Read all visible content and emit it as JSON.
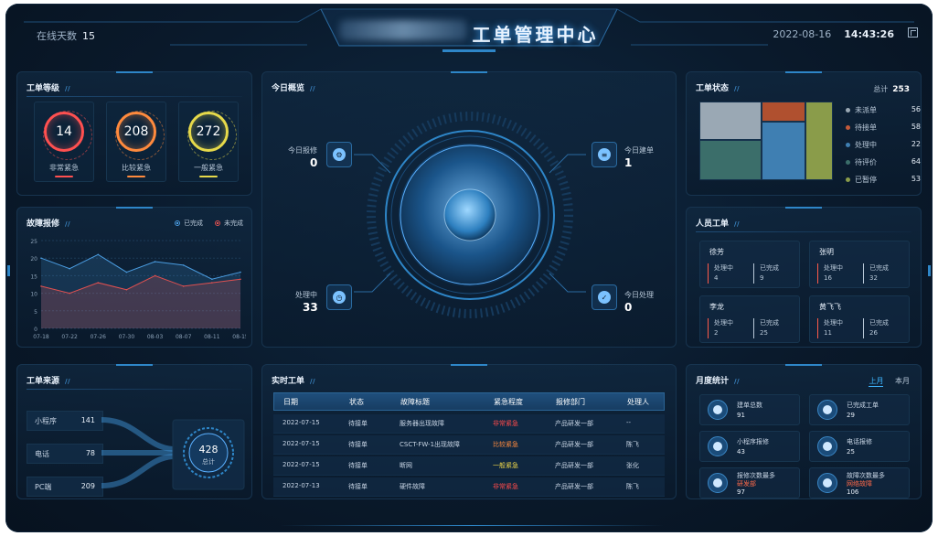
{
  "header": {
    "title": "工单管理中心",
    "online_label": "在线天数",
    "online_days": "15",
    "date": "2022-08-16",
    "time": "14:43:26",
    "fullscreen_icon": "fullscreen-icon"
  },
  "level": {
    "title": "工单等级",
    "items": [
      {
        "value": "14",
        "label": "非常紧急",
        "color": "#ff5050"
      },
      {
        "value": "208",
        "label": "比较紧急",
        "color": "#ff8a3d"
      },
      {
        "value": "272",
        "label": "一般紧急",
        "color": "#e6d94a"
      }
    ]
  },
  "fault": {
    "title": "故障报修",
    "legend_done": "已完成",
    "legend_undone": "未完成",
    "done_color": "#4a9ce0",
    "undone_color": "#e05050"
  },
  "chart_data": {
    "type": "area",
    "title": "故障报修",
    "categories": [
      "07-18",
      "07-22",
      "07-26",
      "07-30",
      "08-03",
      "08-07",
      "08-11",
      "08-15"
    ],
    "ylim": [
      0,
      25
    ],
    "yticks": [
      "25",
      "20",
      "15",
      "10",
      "5",
      "0"
    ],
    "series": [
      {
        "name": "已完成",
        "values": [
          20,
          17,
          21,
          16,
          19,
          18,
          14,
          16
        ]
      },
      {
        "name": "未完成",
        "values": [
          12,
          10,
          13,
          11,
          15,
          12,
          13,
          14
        ]
      }
    ],
    "legend": "top-right",
    "grid": true
  },
  "overview": {
    "title": "今日概览",
    "items": [
      {
        "label": "今日报修",
        "value": "0"
      },
      {
        "label": "今日建单",
        "value": "1"
      },
      {
        "label": "处理中",
        "value": "33"
      },
      {
        "label": "今日处理",
        "value": "0"
      }
    ]
  },
  "status": {
    "title": "工单状态",
    "total_label": "总计",
    "total": "253",
    "items": [
      {
        "label": "未派单",
        "value": "56",
        "color": "#9aa8b4"
      },
      {
        "label": "待接单",
        "value": "58",
        "color": "#c45a3a"
      },
      {
        "label": "处理中",
        "value": "22",
        "color": "#3f7fb2"
      },
      {
        "label": "待评价",
        "value": "64",
        "color": "#3b6e6a"
      },
      {
        "label": "已暂停",
        "value": "53",
        "color": "#8a9c4a"
      }
    ]
  },
  "personnel": {
    "title": "人员工单",
    "processing_label": "处理中",
    "done_label": "已完成",
    "people": [
      {
        "name": "徐芳",
        "processing": "4",
        "done": "9"
      },
      {
        "name": "张明",
        "processing": "16",
        "done": "32"
      },
      {
        "name": "李龙",
        "processing": "2",
        "done": "25"
      },
      {
        "name": "黄飞飞",
        "processing": "11",
        "done": "26"
      }
    ]
  },
  "source": {
    "title": "工单来源",
    "items": [
      {
        "label": "小程序",
        "value": "141"
      },
      {
        "label": "电话",
        "value": "78"
      },
      {
        "label": "PC端",
        "value": "209"
      }
    ],
    "total": "428",
    "total_label": "总计"
  },
  "realtime": {
    "title": "实时工单",
    "headers": [
      "日期",
      "状态",
      "故障标题",
      "紧急程度",
      "报修部门",
      "处理人"
    ],
    "rows": [
      {
        "date": "2022-07-15",
        "status": "待接单",
        "title": "服务器出现故障",
        "urgency": "非常紧急",
        "urgency_color": "#ff4a4a",
        "dept": "产品研发一部",
        "handler": "--"
      },
      {
        "date": "2022-07-15",
        "status": "待接单",
        "title": "CSCT-FW-1出现故障",
        "urgency": "比较紧急",
        "urgency_color": "#ff8a3d",
        "dept": "产品研发一部",
        "handler": "陈飞"
      },
      {
        "date": "2022-07-15",
        "status": "待接单",
        "title": "断网",
        "urgency": "一般紧急",
        "urgency_color": "#f0d84a",
        "dept": "产品研发一部",
        "handler": "张化"
      },
      {
        "date": "2022-07-13",
        "status": "待接单",
        "title": "硬件故障",
        "urgency": "非常紧急",
        "urgency_color": "#ff4a4a",
        "dept": "产品研发一部",
        "handler": "陈飞"
      }
    ]
  },
  "monthly": {
    "title": "月度统计",
    "tab_last": "上月",
    "tab_this": "本月",
    "cards": [
      {
        "label": "建单总数",
        "value": "91",
        "icon": "document-icon"
      },
      {
        "label": "已完成工单",
        "value": "29",
        "icon": "check-icon"
      },
      {
        "label": "小程序报修",
        "value": "43",
        "icon": "clock-icon"
      },
      {
        "label": "电话报修",
        "value": "25",
        "icon": "phone-icon"
      },
      {
        "label": "报修次数最多",
        "sub": "研发部",
        "value": "97",
        "icon": "user-icon"
      },
      {
        "label": "故障次数最多",
        "sub": "网络故障",
        "value": "106",
        "icon": "warning-icon"
      }
    ]
  }
}
